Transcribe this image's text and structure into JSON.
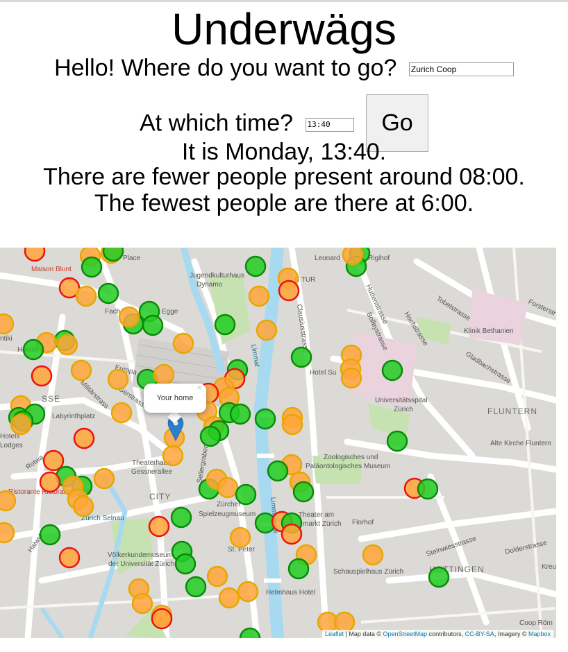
{
  "header": {
    "title": "Underwägs"
  },
  "destination": {
    "question": "Hello! Where do you want to go?",
    "value": "Zurich Coop"
  },
  "time": {
    "question": "At which time?",
    "value": "13:40",
    "go_label": "Go"
  },
  "result": {
    "line1": "It is Monday, 13:40.",
    "line2": "There are fewer people present around 08:00.",
    "line3": "The fewest people are there at 6:00."
  },
  "map": {
    "popup_text": "Your home",
    "popup_close": "×",
    "attribution": {
      "leaflet": "Leaflet",
      "sep1": " | Map data © ",
      "osm": "OpenStreetMap",
      "sep2": " contributors, ",
      "license": "CC-BY-SA",
      "sep3": ", Imagery © ",
      "mapbox": "Mapbox"
    },
    "marker_colors": {
      "green": "#22cc22",
      "green_border": "#0a8a0a",
      "orange": "#ffa43a",
      "orange_border": "#e6a800",
      "red_border": "#ee1111"
    },
    "labels": [
      "Maison Blunt",
      "Jugendkulturhaus",
      "Dynamo",
      "Leonard",
      "Rigihof",
      "Fach",
      "Egge",
      "Hotel Su",
      "Klinik Bethanien",
      "Universitätsspital",
      "Zürich",
      "FLUNTERN",
      "Labyrinthplatz",
      "Alte Kirche Fluntern",
      "Zoologisches und",
      "Paläontologisches Museum",
      "Theaterhaus",
      "Gessnerallee",
      "CITY",
      "Zürcher",
      "Spielzeugmuseum",
      "Theater am",
      "markt Zürich",
      "Florhof",
      "Zürich Selnau",
      "Völkerkundemuseum",
      "der Universität Zürich",
      "St. Peter",
      "Schauspielhaus Zürich",
      "HOTTINGEN",
      "Helmhaus Hotel",
      "Coop Röm",
      "Dolderstrasse",
      "Steinwiesstrasse",
      "Tobelstrasse",
      "Forsterstr",
      "Gladbachstrasse",
      "Huttenstrasse",
      "Bolleystrasse",
      "Hochstrasse",
      "Clausiusstrasse",
      "Limmat",
      "Limmatquai",
      "Europa",
      "Militärstrass",
      "Hotels",
      "Lodges",
      "Rotwa",
      "Halwyl",
      "Ristorante",
      "Hostel",
      "ntiki",
      "Place",
      "H TUR",
      "Kreu",
      "SSE",
      "Gerstrasse",
      "Seilergraben",
      "Ristorante Mare"
    ]
  }
}
